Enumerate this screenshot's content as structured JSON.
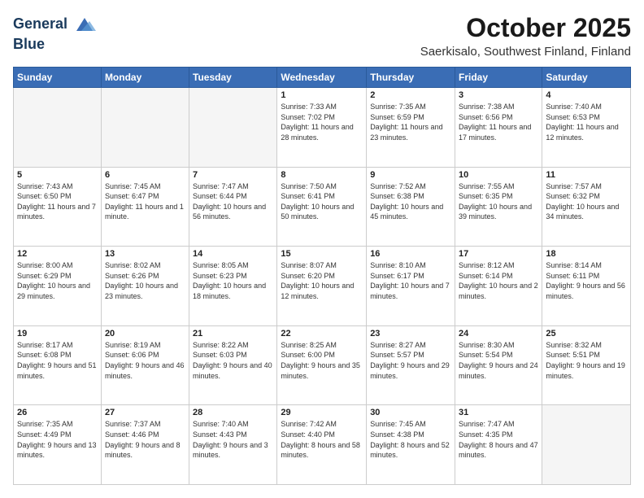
{
  "header": {
    "logo_line1": "General",
    "logo_line2": "Blue",
    "title": "October 2025",
    "subtitle": "Saerkisalo, Southwest Finland, Finland"
  },
  "days_of_week": [
    "Sunday",
    "Monday",
    "Tuesday",
    "Wednesday",
    "Thursday",
    "Friday",
    "Saturday"
  ],
  "weeks": [
    [
      {
        "day": "",
        "info": ""
      },
      {
        "day": "",
        "info": ""
      },
      {
        "day": "",
        "info": ""
      },
      {
        "day": "1",
        "info": "Sunrise: 7:33 AM\nSunset: 7:02 PM\nDaylight: 11 hours and 28 minutes."
      },
      {
        "day": "2",
        "info": "Sunrise: 7:35 AM\nSunset: 6:59 PM\nDaylight: 11 hours and 23 minutes."
      },
      {
        "day": "3",
        "info": "Sunrise: 7:38 AM\nSunset: 6:56 PM\nDaylight: 11 hours and 17 minutes."
      },
      {
        "day": "4",
        "info": "Sunrise: 7:40 AM\nSunset: 6:53 PM\nDaylight: 11 hours and 12 minutes."
      }
    ],
    [
      {
        "day": "5",
        "info": "Sunrise: 7:43 AM\nSunset: 6:50 PM\nDaylight: 11 hours and 7 minutes."
      },
      {
        "day": "6",
        "info": "Sunrise: 7:45 AM\nSunset: 6:47 PM\nDaylight: 11 hours and 1 minute."
      },
      {
        "day": "7",
        "info": "Sunrise: 7:47 AM\nSunset: 6:44 PM\nDaylight: 10 hours and 56 minutes."
      },
      {
        "day": "8",
        "info": "Sunrise: 7:50 AM\nSunset: 6:41 PM\nDaylight: 10 hours and 50 minutes."
      },
      {
        "day": "9",
        "info": "Sunrise: 7:52 AM\nSunset: 6:38 PM\nDaylight: 10 hours and 45 minutes."
      },
      {
        "day": "10",
        "info": "Sunrise: 7:55 AM\nSunset: 6:35 PM\nDaylight: 10 hours and 39 minutes."
      },
      {
        "day": "11",
        "info": "Sunrise: 7:57 AM\nSunset: 6:32 PM\nDaylight: 10 hours and 34 minutes."
      }
    ],
    [
      {
        "day": "12",
        "info": "Sunrise: 8:00 AM\nSunset: 6:29 PM\nDaylight: 10 hours and 29 minutes."
      },
      {
        "day": "13",
        "info": "Sunrise: 8:02 AM\nSunset: 6:26 PM\nDaylight: 10 hours and 23 minutes."
      },
      {
        "day": "14",
        "info": "Sunrise: 8:05 AM\nSunset: 6:23 PM\nDaylight: 10 hours and 18 minutes."
      },
      {
        "day": "15",
        "info": "Sunrise: 8:07 AM\nSunset: 6:20 PM\nDaylight: 10 hours and 12 minutes."
      },
      {
        "day": "16",
        "info": "Sunrise: 8:10 AM\nSunset: 6:17 PM\nDaylight: 10 hours and 7 minutes."
      },
      {
        "day": "17",
        "info": "Sunrise: 8:12 AM\nSunset: 6:14 PM\nDaylight: 10 hours and 2 minutes."
      },
      {
        "day": "18",
        "info": "Sunrise: 8:14 AM\nSunset: 6:11 PM\nDaylight: 9 hours and 56 minutes."
      }
    ],
    [
      {
        "day": "19",
        "info": "Sunrise: 8:17 AM\nSunset: 6:08 PM\nDaylight: 9 hours and 51 minutes."
      },
      {
        "day": "20",
        "info": "Sunrise: 8:19 AM\nSunset: 6:06 PM\nDaylight: 9 hours and 46 minutes."
      },
      {
        "day": "21",
        "info": "Sunrise: 8:22 AM\nSunset: 6:03 PM\nDaylight: 9 hours and 40 minutes."
      },
      {
        "day": "22",
        "info": "Sunrise: 8:25 AM\nSunset: 6:00 PM\nDaylight: 9 hours and 35 minutes."
      },
      {
        "day": "23",
        "info": "Sunrise: 8:27 AM\nSunset: 5:57 PM\nDaylight: 9 hours and 29 minutes."
      },
      {
        "day": "24",
        "info": "Sunrise: 8:30 AM\nSunset: 5:54 PM\nDaylight: 9 hours and 24 minutes."
      },
      {
        "day": "25",
        "info": "Sunrise: 8:32 AM\nSunset: 5:51 PM\nDaylight: 9 hours and 19 minutes."
      }
    ],
    [
      {
        "day": "26",
        "info": "Sunrise: 7:35 AM\nSunset: 4:49 PM\nDaylight: 9 hours and 13 minutes."
      },
      {
        "day": "27",
        "info": "Sunrise: 7:37 AM\nSunset: 4:46 PM\nDaylight: 9 hours and 8 minutes."
      },
      {
        "day": "28",
        "info": "Sunrise: 7:40 AM\nSunset: 4:43 PM\nDaylight: 9 hours and 3 minutes."
      },
      {
        "day": "29",
        "info": "Sunrise: 7:42 AM\nSunset: 4:40 PM\nDaylight: 8 hours and 58 minutes."
      },
      {
        "day": "30",
        "info": "Sunrise: 7:45 AM\nSunset: 4:38 PM\nDaylight: 8 hours and 52 minutes."
      },
      {
        "day": "31",
        "info": "Sunrise: 7:47 AM\nSunset: 4:35 PM\nDaylight: 8 hours and 47 minutes."
      },
      {
        "day": "",
        "info": ""
      }
    ]
  ]
}
